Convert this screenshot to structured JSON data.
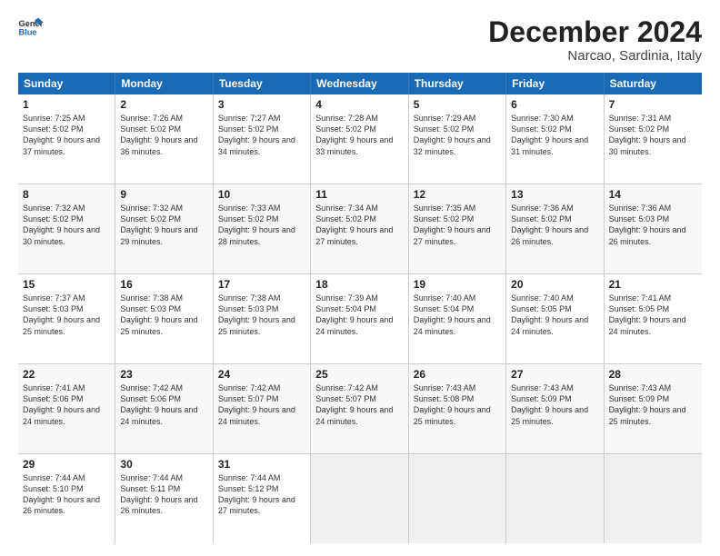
{
  "logo": {
    "line1": "General",
    "line2": "Blue"
  },
  "title": "December 2024",
  "location": "Narcao, Sardinia, Italy",
  "days_of_week": [
    "Sunday",
    "Monday",
    "Tuesday",
    "Wednesday",
    "Thursday",
    "Friday",
    "Saturday"
  ],
  "weeks": [
    [
      {
        "day": "1",
        "sunrise": "7:25 AM",
        "sunset": "5:02 PM",
        "daylight": "9 hours and 37 minutes."
      },
      {
        "day": "2",
        "sunrise": "7:26 AM",
        "sunset": "5:02 PM",
        "daylight": "9 hours and 36 minutes."
      },
      {
        "day": "3",
        "sunrise": "7:27 AM",
        "sunset": "5:02 PM",
        "daylight": "9 hours and 34 minutes."
      },
      {
        "day": "4",
        "sunrise": "7:28 AM",
        "sunset": "5:02 PM",
        "daylight": "9 hours and 33 minutes."
      },
      {
        "day": "5",
        "sunrise": "7:29 AM",
        "sunset": "5:02 PM",
        "daylight": "9 hours and 32 minutes."
      },
      {
        "day": "6",
        "sunrise": "7:30 AM",
        "sunset": "5:02 PM",
        "daylight": "9 hours and 31 minutes."
      },
      {
        "day": "7",
        "sunrise": "7:31 AM",
        "sunset": "5:02 PM",
        "daylight": "9 hours and 30 minutes."
      }
    ],
    [
      {
        "day": "8",
        "sunrise": "7:32 AM",
        "sunset": "5:02 PM",
        "daylight": "9 hours and 30 minutes."
      },
      {
        "day": "9",
        "sunrise": "7:32 AM",
        "sunset": "5:02 PM",
        "daylight": "9 hours and 29 minutes."
      },
      {
        "day": "10",
        "sunrise": "7:33 AM",
        "sunset": "5:02 PM",
        "daylight": "9 hours and 28 minutes."
      },
      {
        "day": "11",
        "sunrise": "7:34 AM",
        "sunset": "5:02 PM",
        "daylight": "9 hours and 27 minutes."
      },
      {
        "day": "12",
        "sunrise": "7:35 AM",
        "sunset": "5:02 PM",
        "daylight": "9 hours and 27 minutes."
      },
      {
        "day": "13",
        "sunrise": "7:36 AM",
        "sunset": "5:02 PM",
        "daylight": "9 hours and 26 minutes."
      },
      {
        "day": "14",
        "sunrise": "7:36 AM",
        "sunset": "5:03 PM",
        "daylight": "9 hours and 26 minutes."
      }
    ],
    [
      {
        "day": "15",
        "sunrise": "7:37 AM",
        "sunset": "5:03 PM",
        "daylight": "9 hours and 25 minutes."
      },
      {
        "day": "16",
        "sunrise": "7:38 AM",
        "sunset": "5:03 PM",
        "daylight": "9 hours and 25 minutes."
      },
      {
        "day": "17",
        "sunrise": "7:38 AM",
        "sunset": "5:03 PM",
        "daylight": "9 hours and 25 minutes."
      },
      {
        "day": "18",
        "sunrise": "7:39 AM",
        "sunset": "5:04 PM",
        "daylight": "9 hours and 24 minutes."
      },
      {
        "day": "19",
        "sunrise": "7:40 AM",
        "sunset": "5:04 PM",
        "daylight": "9 hours and 24 minutes."
      },
      {
        "day": "20",
        "sunrise": "7:40 AM",
        "sunset": "5:05 PM",
        "daylight": "9 hours and 24 minutes."
      },
      {
        "day": "21",
        "sunrise": "7:41 AM",
        "sunset": "5:05 PM",
        "daylight": "9 hours and 24 minutes."
      }
    ],
    [
      {
        "day": "22",
        "sunrise": "7:41 AM",
        "sunset": "5:06 PM",
        "daylight": "9 hours and 24 minutes."
      },
      {
        "day": "23",
        "sunrise": "7:42 AM",
        "sunset": "5:06 PM",
        "daylight": "9 hours and 24 minutes."
      },
      {
        "day": "24",
        "sunrise": "7:42 AM",
        "sunset": "5:07 PM",
        "daylight": "9 hours and 24 minutes."
      },
      {
        "day": "25",
        "sunrise": "7:42 AM",
        "sunset": "5:07 PM",
        "daylight": "9 hours and 24 minutes."
      },
      {
        "day": "26",
        "sunrise": "7:43 AM",
        "sunset": "5:08 PM",
        "daylight": "9 hours and 25 minutes."
      },
      {
        "day": "27",
        "sunrise": "7:43 AM",
        "sunset": "5:09 PM",
        "daylight": "9 hours and 25 minutes."
      },
      {
        "day": "28",
        "sunrise": "7:43 AM",
        "sunset": "5:09 PM",
        "daylight": "9 hours and 25 minutes."
      }
    ],
    [
      {
        "day": "29",
        "sunrise": "7:44 AM",
        "sunset": "5:10 PM",
        "daylight": "9 hours and 26 minutes."
      },
      {
        "day": "30",
        "sunrise": "7:44 AM",
        "sunset": "5:11 PM",
        "daylight": "9 hours and 26 minutes."
      },
      {
        "day": "31",
        "sunrise": "7:44 AM",
        "sunset": "5:12 PM",
        "daylight": "9 hours and 27 minutes."
      },
      null,
      null,
      null,
      null
    ]
  ]
}
